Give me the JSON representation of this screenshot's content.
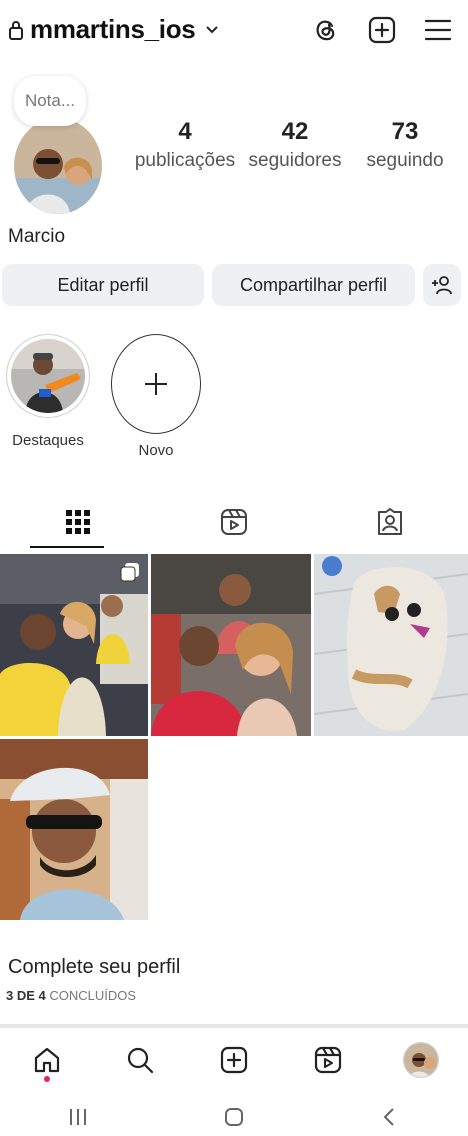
{
  "header": {
    "username": "mmartins_ios",
    "icons": [
      "lock-icon",
      "chevron-down-icon",
      "threads-icon",
      "new-post-icon",
      "menu-icon"
    ]
  },
  "profile": {
    "note_placeholder": "Nota...",
    "display_name": "Marcio",
    "stats": [
      {
        "value": "4",
        "label": "publicações"
      },
      {
        "value": "42",
        "label": "seguidores"
      },
      {
        "value": "73",
        "label": "seguindo"
      }
    ]
  },
  "buttons": {
    "edit": "Editar perfil",
    "share": "Compartilhar perfil",
    "discover_icon": "add-person-icon"
  },
  "highlights": [
    {
      "label": "Destaques"
    },
    {
      "label": "Novo"
    }
  ],
  "tabs": [
    {
      "name": "grid",
      "icon": "grid-icon",
      "active": true
    },
    {
      "name": "reels",
      "icon": "reels-icon",
      "active": false
    },
    {
      "name": "tagged",
      "icon": "tagged-icon",
      "active": false
    }
  ],
  "posts": [
    {
      "kind": "carousel"
    },
    {
      "kind": "photo"
    },
    {
      "kind": "photo"
    },
    {
      "kind": "photo"
    }
  ],
  "complete_profile": {
    "title": "Complete seu perfil",
    "count": "3 DE 4",
    "rest": "CONCLUÍDOS",
    "progress_fraction": 0.75
  },
  "bottom_nav": [
    "home-icon",
    "search-icon",
    "create-icon",
    "reels-icon",
    "profile-avatar"
  ],
  "colors": {
    "button_bg": "#eef0f2",
    "notification_dot": "#e0245e",
    "text": "#111111"
  }
}
